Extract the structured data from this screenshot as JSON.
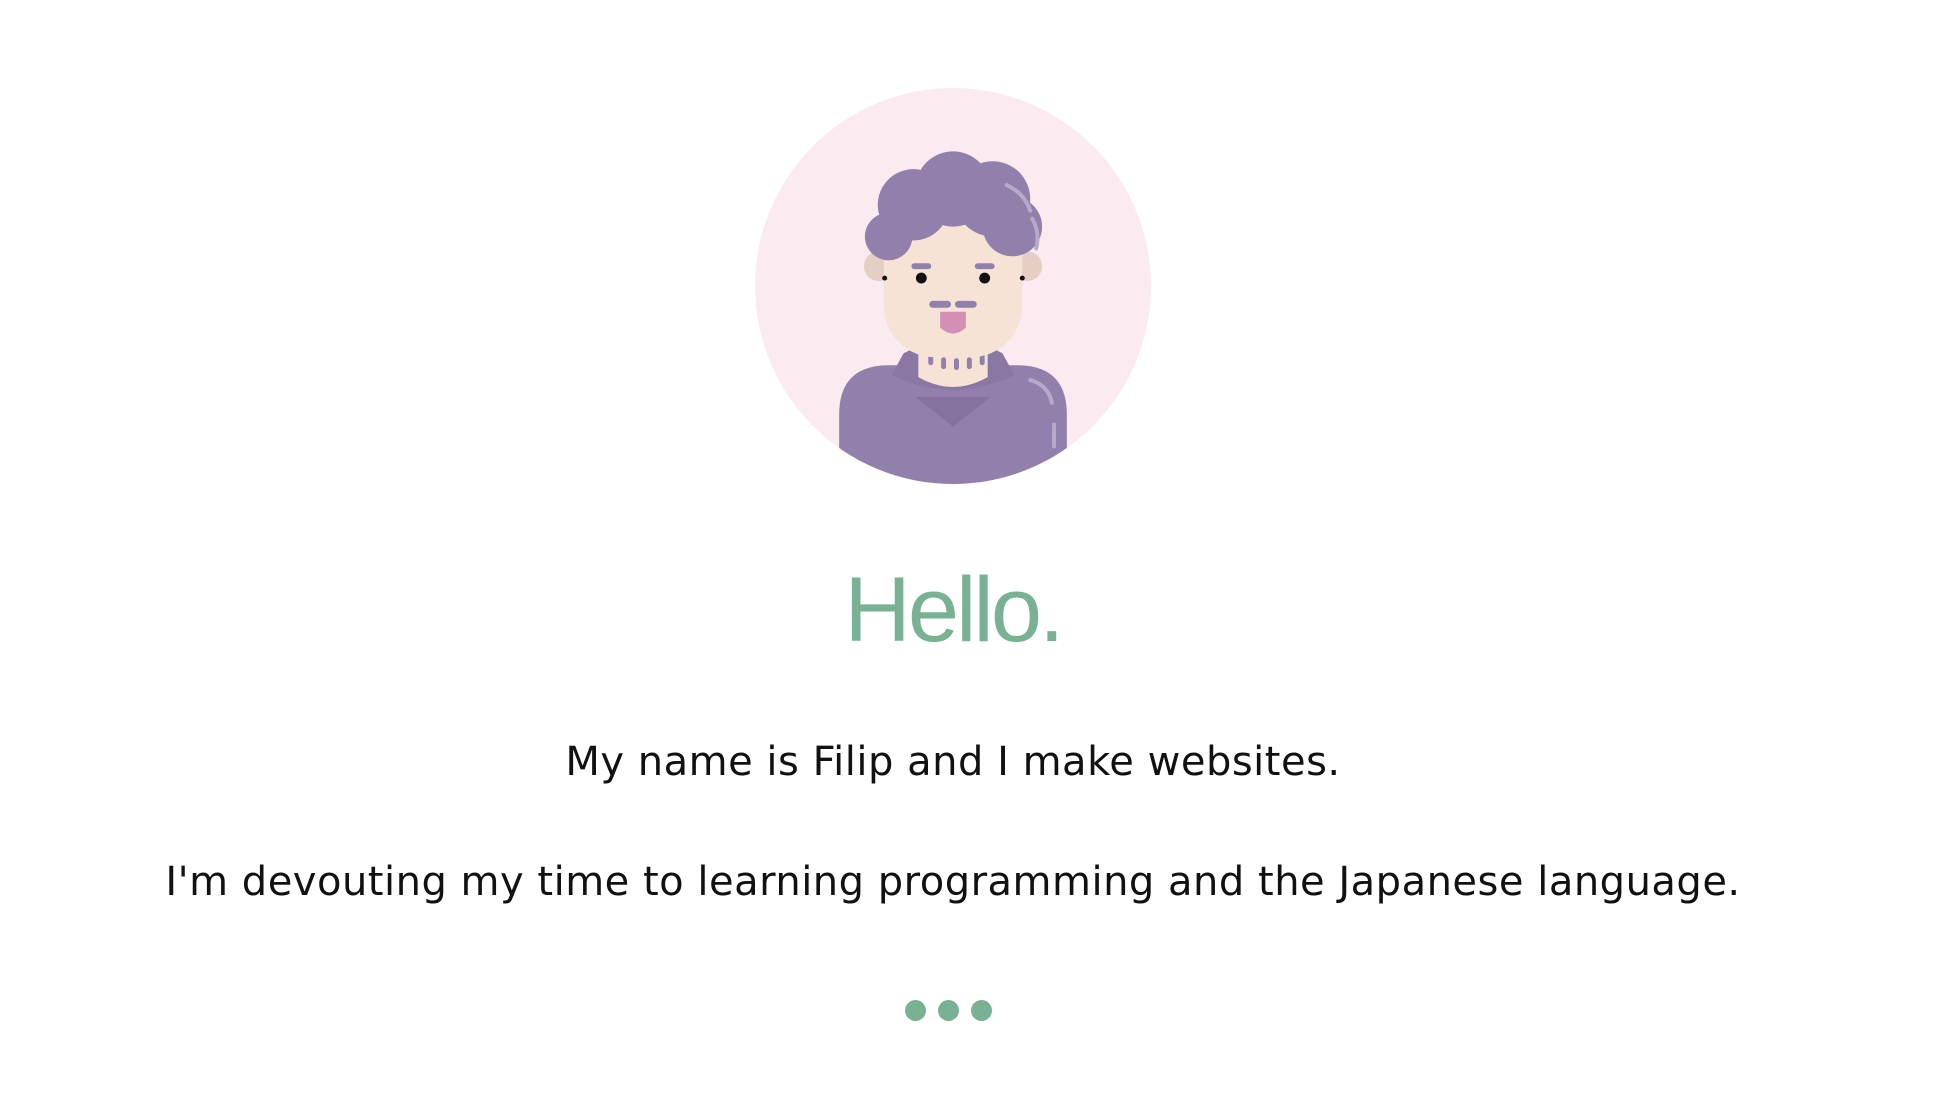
{
  "hero": {
    "avatar_icon": "cartoon-avatar-icon",
    "greeting": "Hello.",
    "intro_lines": [
      "My name is Filip and I make websites.",
      "I'm devouting my time to learning programming and the Japanese language."
    ],
    "more_icon": "ellipsis-dots-icon"
  },
  "colors": {
    "accent": "#78b292",
    "avatar_bg": "#fbebf1",
    "hair_and_shirt": "#9180ab",
    "skin": "#f7e2d6",
    "text": "#111111"
  }
}
